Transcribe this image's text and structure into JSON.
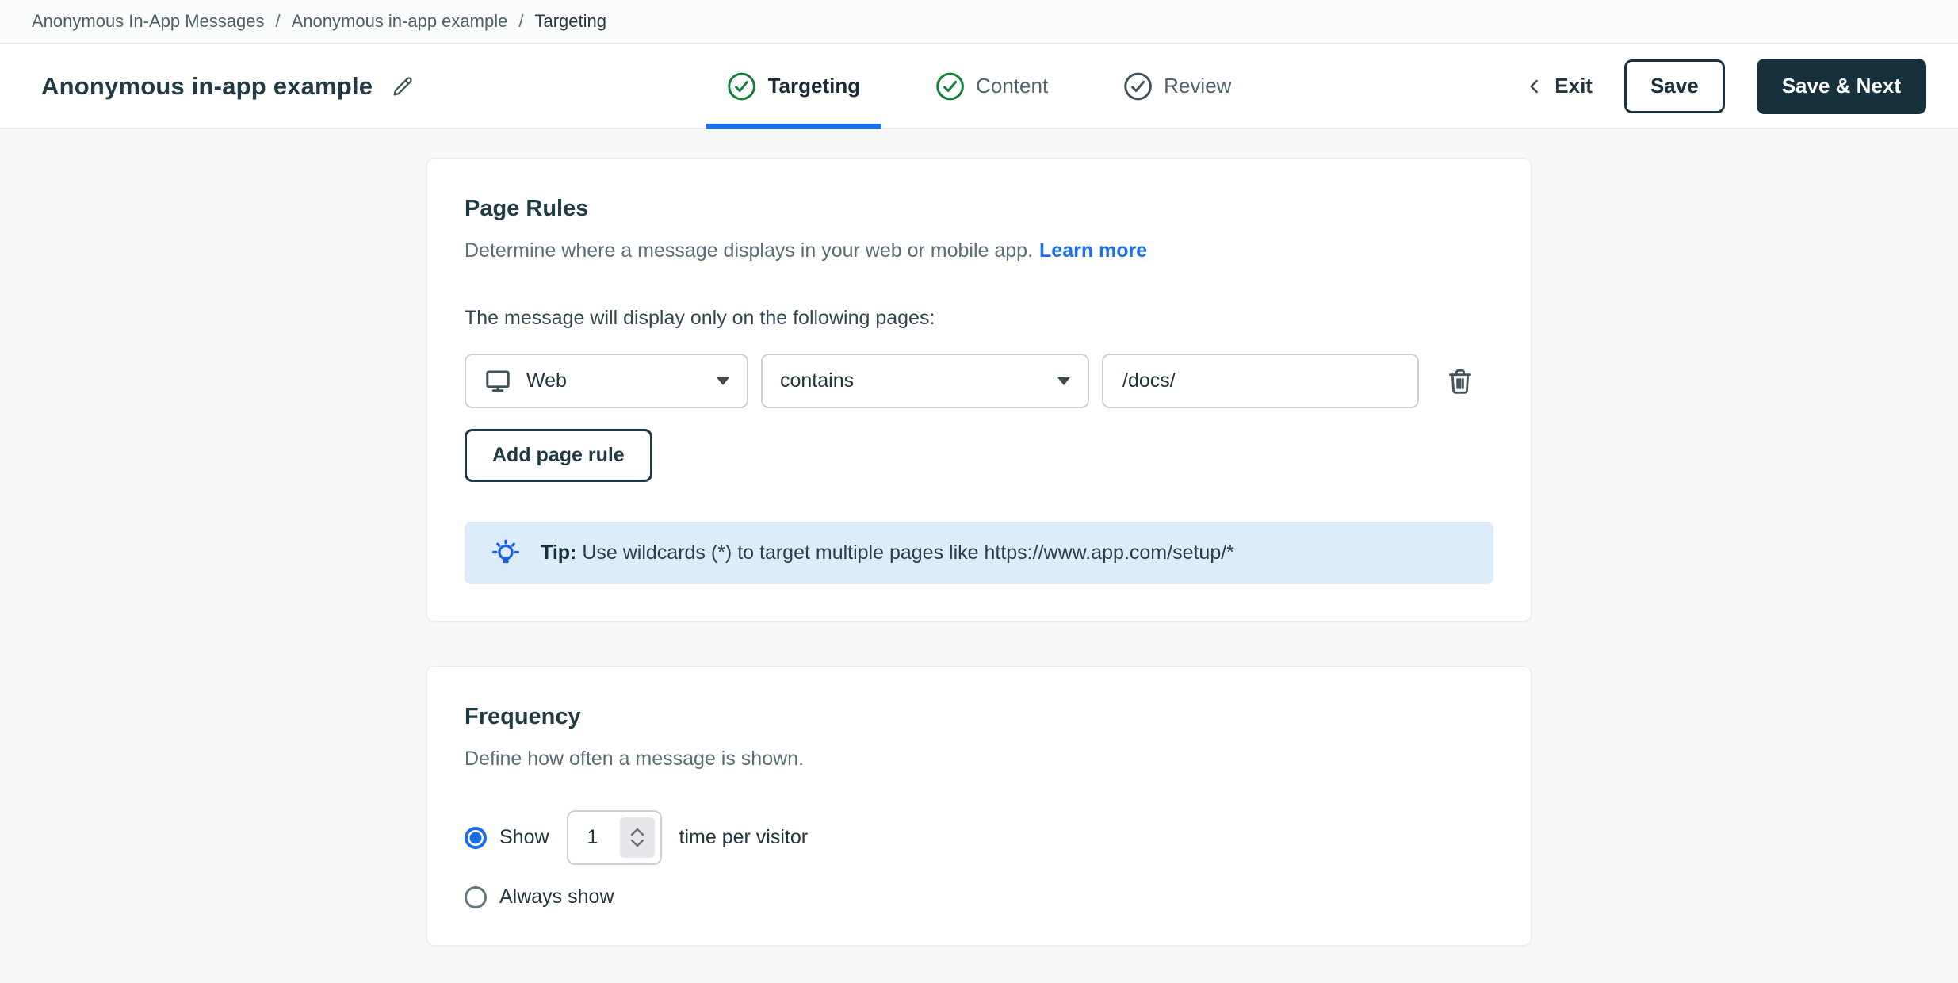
{
  "colors": {
    "accent_blue": "#1b72e8",
    "link_blue": "#1b72e8",
    "success_green": "#14803c",
    "dark_teal_button": "#16313b",
    "tip_background": "#ddecfa",
    "radio_blue": "#1a6fe8"
  },
  "breadcrumb": {
    "separator": "/",
    "items": [
      "Anonymous In-App Messages",
      "Anonymous in-app example",
      "Targeting"
    ]
  },
  "header": {
    "title": "Anonymous in-app example",
    "tabs": [
      {
        "label": "Targeting",
        "state": "active",
        "check_color": "green"
      },
      {
        "label": "Content",
        "state": "complete",
        "check_color": "green"
      },
      {
        "label": "Review",
        "state": "default",
        "check_color": "gray"
      }
    ],
    "exit_label": "Exit",
    "save_label": "Save",
    "save_next_label": "Save & Next"
  },
  "page_rules": {
    "title": "Page Rules",
    "description": "Determine where a message displays in your web or mobile app.",
    "learn_more_label": "Learn more",
    "condition_intro": "The message will display only on the following pages:",
    "rule": {
      "platform": "Web",
      "operator": "contains",
      "value": "/docs/"
    },
    "add_button_label": "Add page rule",
    "tip_label": "Tip:",
    "tip_text": "Use wildcards (*) to target multiple pages like https://www.app.com/setup/*"
  },
  "frequency": {
    "title": "Frequency",
    "description": "Define how often a message is shown.",
    "options": [
      {
        "label_before": "Show",
        "value": "1",
        "label_after": "time per visitor",
        "selected": true
      },
      {
        "label": "Always show",
        "selected": false
      }
    ]
  }
}
